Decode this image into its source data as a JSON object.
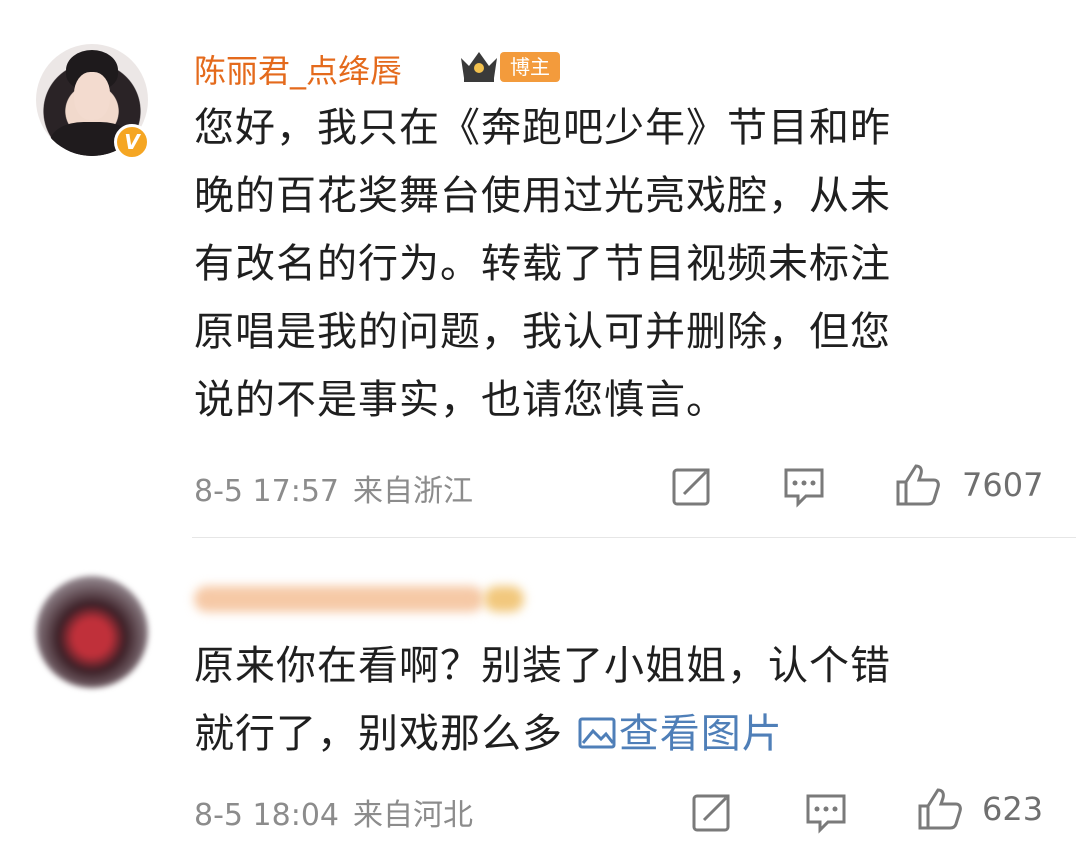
{
  "comments": [
    {
      "username": "陈丽君_点绛唇",
      "verified_badge": "V",
      "role_badge": "博主",
      "lines": [
        "您好，我只在《奔跑吧少年》节目和昨",
        "晚的百花奖舞台使用过光亮戏腔，从未",
        "有改名的行为。转载了节目视频未标注",
        "原唱是我的问题，我认可并删除，但您",
        "说的不是事实，也请您慎言。"
      ],
      "time": "8-5 17:57",
      "location": "来自浙江",
      "likes": "7607"
    },
    {
      "lines": [
        "原来你在看啊？别装了小姐姐，认个错",
        "就行了，别戏那么多"
      ],
      "view_image": "查看图片",
      "time": "8-5 18:04",
      "location": "来自河北",
      "likes": "623"
    }
  ],
  "colors": {
    "username": "#e46a1c",
    "badge": "#f39b3c",
    "link": "#4f7fb8",
    "meta": "#8c8c8c"
  },
  "icons": [
    "crown-icon",
    "repost-icon",
    "reply-icon",
    "like-icon",
    "image-icon"
  ]
}
